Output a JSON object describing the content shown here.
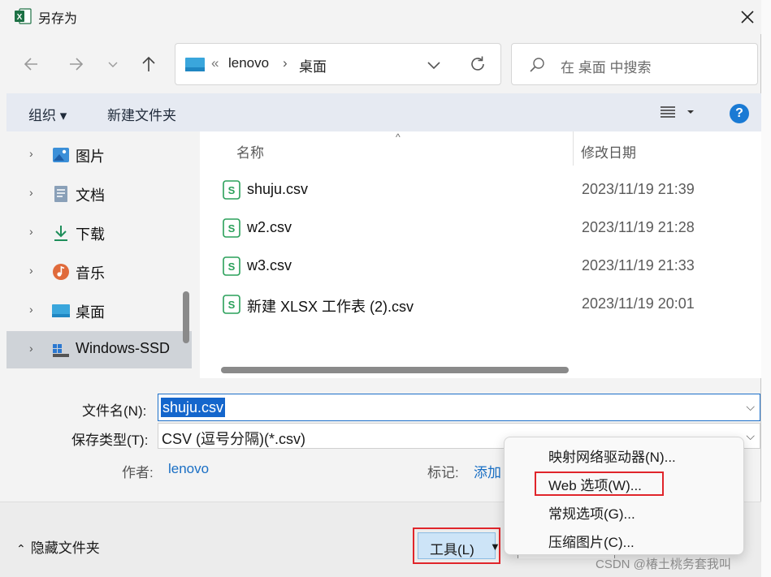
{
  "window": {
    "title": "另存为"
  },
  "address": {
    "ellipsis": "«",
    "segment1": "lenovo",
    "separator": "›",
    "segment2": "桌面"
  },
  "search": {
    "placeholder": "在 桌面 中搜索"
  },
  "toolbar": {
    "organize": "组织 ▾",
    "new_folder": "新建文件夹"
  },
  "sidebar": {
    "items": [
      {
        "label": "图片",
        "icon": "pictures-icon"
      },
      {
        "label": "文档",
        "icon": "documents-icon"
      },
      {
        "label": "下载",
        "icon": "downloads-icon"
      },
      {
        "label": "音乐",
        "icon": "music-icon"
      },
      {
        "label": "桌面",
        "icon": "desktop-icon"
      },
      {
        "label": "Windows-SSD",
        "icon": "drive-icon"
      }
    ]
  },
  "files": {
    "col_name": "名称",
    "col_date": "修改日期",
    "rows": [
      {
        "name": "shuju.csv",
        "date": "2023/11/19 21:39"
      },
      {
        "name": "w2.csv",
        "date": "2023/11/19 21:28"
      },
      {
        "name": "w3.csv",
        "date": "2023/11/19 21:33"
      },
      {
        "name": "新建 XLSX 工作表 (2).csv",
        "date": "2023/11/19 20:01"
      }
    ]
  },
  "form": {
    "filename_label": "文件名(N):",
    "filename_value": "shuju.csv",
    "filetype_label": "保存类型(T):",
    "filetype_value": "CSV (逗号分隔)(*.csv)",
    "author_label": "作者:",
    "author_value": "lenovo",
    "tags_label": "标记:",
    "tags_value": "添加"
  },
  "footer": {
    "hide_folders": "隐藏文件夹",
    "tools_label": "工具(L)"
  },
  "menu": {
    "items": [
      "映射网络驱动器(N)...",
      "Web 选项(W)...",
      "常规选项(G)...",
      "压缩图片(C)..."
    ]
  },
  "watermark": "CSDN @椿土桃务套我叫",
  "colors": {
    "accent": "#1466cc",
    "highlight_box": "#e0252b",
    "help": "#1a7ad4"
  }
}
